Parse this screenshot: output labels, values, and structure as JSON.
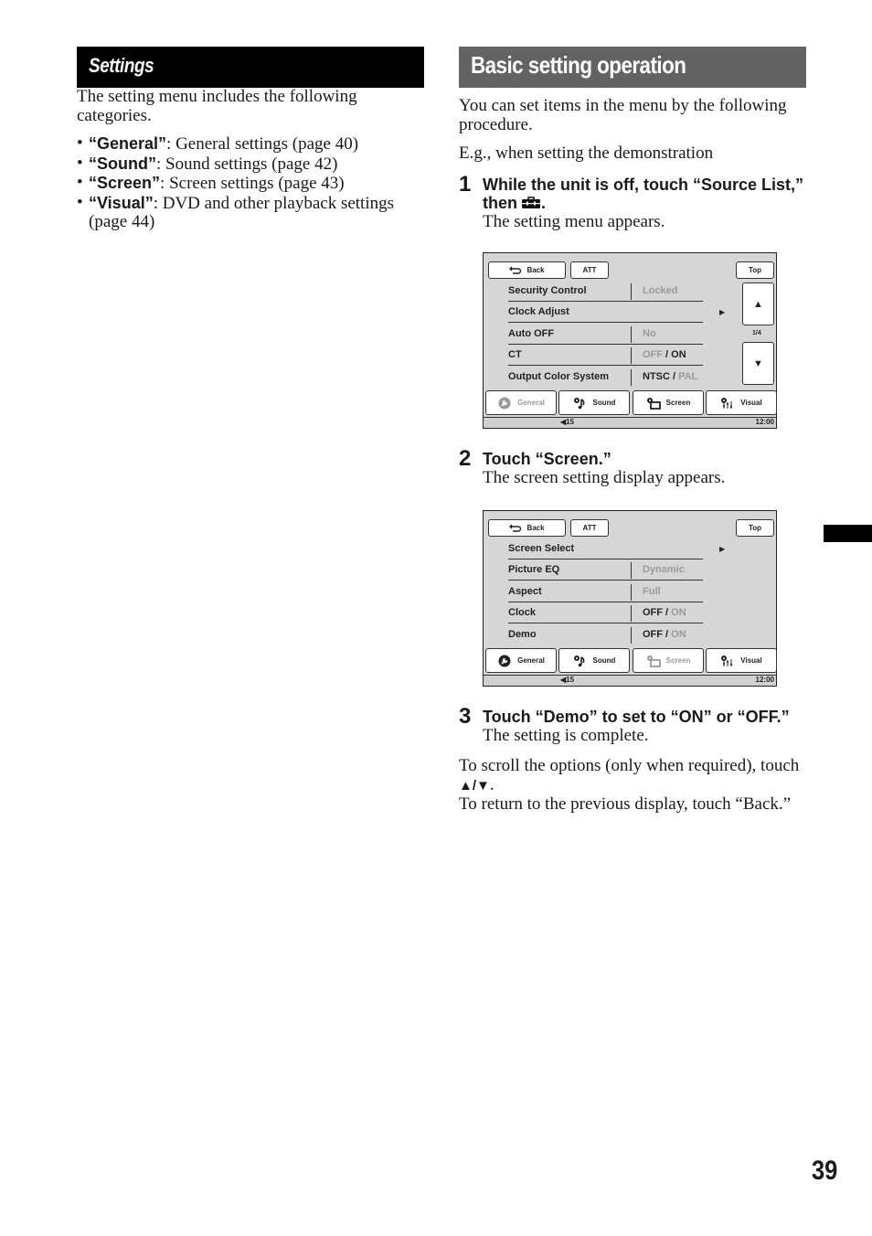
{
  "left": {
    "heading": "Settings",
    "intro": "The setting menu includes the following categories.",
    "categories": [
      {
        "name": "“General”",
        "desc": ": General settings (page 40)"
      },
      {
        "name": "“Sound”",
        "desc": ": Sound settings (page 42)"
      },
      {
        "name": "“Screen”",
        "desc": ": Screen settings (page 43)"
      },
      {
        "name": "“Visual”",
        "desc": ": DVD and other playback settings (page 44)"
      }
    ]
  },
  "right": {
    "heading": "Basic setting operation",
    "intro": "You can set items in the menu by the following procedure.",
    "example": "E.g., when setting the demonstration",
    "steps": [
      {
        "num": "1",
        "title": "While the unit is off, touch “Source List,” then",
        "title_suffix": ".",
        "icon": "toolbox-icon",
        "result": "The setting menu appears."
      },
      {
        "num": "2",
        "title": "Touch “Screen.”",
        "result": "The screen setting display appears."
      },
      {
        "num": "3",
        "title": "Touch “Demo” to set to “ON” or “OFF.”",
        "result": "The setting is complete."
      }
    ],
    "note_scroll": "To scroll the options (only when required), touch",
    "note_scroll_symbols": "▲/▼",
    "note_back": "To return to the previous display, touch “Back.”"
  },
  "screen1": {
    "back": "Back",
    "att": "ATT",
    "top": "Top",
    "page_indicator": "1/4",
    "rows": [
      {
        "label": "Security Control",
        "value": "Locked"
      },
      {
        "label": "Clock Adjust",
        "value": ""
      },
      {
        "label": "Auto OFF",
        "value": "No"
      },
      {
        "label": "CT",
        "value_a": "OFF",
        "slash": " / ",
        "value_b": "ON"
      },
      {
        "label": "Output Color System",
        "value_a": "NTSC",
        "slash": " / ",
        "value_b": "PAL"
      }
    ],
    "tabs": [
      "General",
      "Sound",
      "Screen",
      "Visual"
    ],
    "volume": "15",
    "clock": "12:00"
  },
  "screen2": {
    "back": "Back",
    "att": "ATT",
    "top": "Top",
    "rows": [
      {
        "label": "Screen Select",
        "value": ""
      },
      {
        "label": "Picture EQ",
        "value": "Dynamic"
      },
      {
        "label": "Aspect",
        "value": "Full"
      },
      {
        "label": "Clock",
        "value_a": "OFF",
        "slash": " / ",
        "value_b": "ON"
      },
      {
        "label": "Demo",
        "value_a": "OFF",
        "slash": " / ",
        "value_b": "ON"
      }
    ],
    "tabs": [
      "General",
      "Sound",
      "Screen",
      "Visual"
    ],
    "volume": "15",
    "clock": "12:00"
  },
  "page_number": "39",
  "colors": {
    "heading_black": "#000000",
    "heading_gray": "#636363",
    "screen_bg": "#d6d6d6",
    "dim_text": "#9a9a9a"
  }
}
